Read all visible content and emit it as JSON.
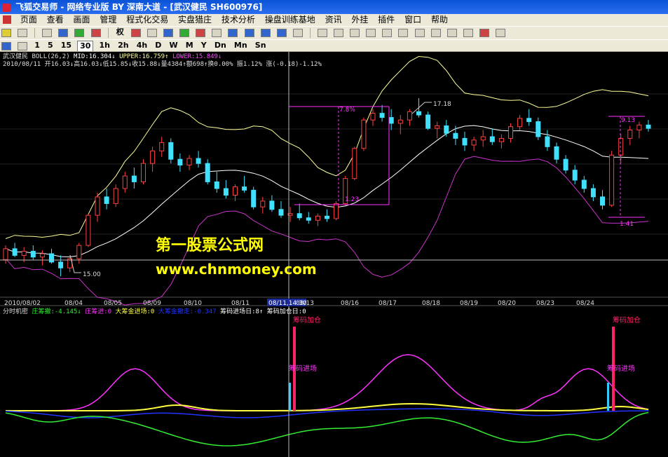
{
  "window": {
    "title": "飞狐交易师 - 网络专业版 BY 深南大道 - [武汉健民 SH600976]"
  },
  "menu": [
    "页面",
    "查看",
    "画面",
    "管理",
    "程式化交易",
    "实盘猎庄",
    "技术分析",
    "操盘训练基地",
    "资讯",
    "外挂",
    "插件",
    "窗口",
    "帮助"
  ],
  "toolbar1": {
    "right_label": "权"
  },
  "periods": [
    {
      "label": "1",
      "active": false
    },
    {
      "label": "5",
      "active": false
    },
    {
      "label": "15",
      "active": false
    },
    {
      "label": "30",
      "active": true
    },
    {
      "label": "1h",
      "active": false
    },
    {
      "label": "2h",
      "active": false
    },
    {
      "label": "4h",
      "active": false
    },
    {
      "label": "D",
      "active": false
    },
    {
      "label": "W",
      "active": false
    },
    {
      "label": "M",
      "active": false
    },
    {
      "label": "Y",
      "active": false
    },
    {
      "label": "Dn",
      "active": false
    },
    {
      "label": "Mn",
      "active": false
    },
    {
      "label": "Sn",
      "active": false
    }
  ],
  "main_info": {
    "stock": "武汉健民",
    "boll": "BOLL(26,2)",
    "mid": "MID:16.304↓",
    "upper": "UPPER:16.759↑",
    "lower": "LOWER:15.849↓",
    "line2": "2010/08/11 开16.03↓高16.03↓低15.85↓收15.88↓量4384↑额698↑换0.00% 振1.12% 涨(-0.18)-1.12%"
  },
  "annotations": {
    "a7_8": "7.8%",
    "a17_18": "17.18",
    "a15_00": "15.00",
    "a1_23": "1.23",
    "a1_41": "1.41",
    "a9_13": "9.13"
  },
  "x_axis": [
    "2010/08/02",
    "08/04",
    "08/05",
    "08/09",
    "08/10",
    "08/11",
    "08/11,14:30",
    "08/13",
    "08/16",
    "08/17",
    "08/18",
    "08/19",
    "08/20",
    "08/23",
    "08/24"
  ],
  "sub_info": {
    "name": "分时机密",
    "a": "庄筹撤:-4.145↓",
    "b": "庄筹进:0",
    "c": "大筹金进场:0",
    "d": "大筹金撤走:-0.347",
    "e": "筹码进场日:8↑",
    "f": "筹码加仓日:0"
  },
  "sub_labels": {
    "jiacang": "筹码加仓",
    "jinchang": "筹码进场"
  },
  "watermark": {
    "line1": "第一股票公式网",
    "line2": "www.chnmoney.com"
  },
  "colors": {
    "bg": "#000000",
    "up_candle": "#ff4040",
    "down_candle": "#40e0ff",
    "upper_band": "#ffff99",
    "mid_band": "#ffffff",
    "lower_band": "#cc33cc",
    "watermark": "#ffff00",
    "osc_magenta": "#ff33ff",
    "osc_yellow": "#ffff40",
    "osc_blue": "#2233ff",
    "osc_green": "#33ee33",
    "bar_pink": "#ff2266",
    "bar_cyan": "#33ccff"
  },
  "chart_data": {
    "type": "candlestick",
    "timeframe": "30",
    "y_min": 14.8,
    "y_max": 17.5,
    "candles": [
      [
        15.25,
        15.42,
        15.2,
        15.38
      ],
      [
        15.38,
        15.45,
        15.28,
        15.3
      ],
      [
        15.3,
        15.4,
        15.22,
        15.35
      ],
      [
        15.35,
        15.42,
        15.25,
        15.28
      ],
      [
        15.28,
        15.36,
        15.18,
        15.32
      ],
      [
        15.32,
        15.38,
        15.2,
        15.22
      ],
      [
        15.22,
        15.3,
        15.05,
        15.15
      ],
      [
        15.15,
        15.3,
        15.1,
        15.26
      ],
      [
        15.26,
        15.45,
        15.2,
        15.42
      ],
      [
        15.42,
        15.8,
        15.4,
        15.78
      ],
      [
        15.78,
        16.05,
        15.7,
        16.0
      ],
      [
        16.0,
        16.1,
        15.85,
        15.92
      ],
      [
        15.92,
        16.15,
        15.88,
        16.1
      ],
      [
        16.1,
        16.3,
        16.05,
        16.25
      ],
      [
        16.25,
        16.35,
        16.1,
        16.18
      ],
      [
        16.18,
        16.45,
        16.15,
        16.4
      ],
      [
        16.4,
        16.6,
        16.3,
        16.55
      ],
      [
        16.55,
        16.72,
        16.48,
        16.65
      ],
      [
        16.65,
        16.7,
        16.4,
        16.45
      ],
      [
        16.45,
        16.52,
        16.3,
        16.38
      ],
      [
        16.38,
        16.5,
        16.32,
        16.46
      ],
      [
        16.46,
        16.55,
        16.35,
        16.4
      ],
      [
        16.4,
        16.45,
        16.15,
        16.18
      ],
      [
        16.18,
        16.3,
        16.05,
        16.1
      ],
      [
        16.1,
        16.2,
        15.98,
        16.02
      ],
      [
        16.02,
        16.15,
        15.95,
        16.12
      ],
      [
        16.12,
        16.25,
        16.05,
        16.08
      ],
      [
        16.08,
        16.12,
        15.85,
        15.88
      ],
      [
        15.88,
        16.0,
        15.8,
        15.95
      ],
      [
        15.95,
        16.02,
        15.82,
        15.85
      ],
      [
        15.85,
        15.95,
        15.75,
        15.78
      ],
      [
        15.78,
        15.88,
        15.7,
        15.8
      ],
      [
        15.8,
        15.92,
        15.72,
        15.75
      ],
      [
        15.75,
        15.82,
        15.68,
        15.72
      ],
      [
        15.72,
        15.8,
        15.65,
        15.77
      ],
      [
        15.77,
        15.85,
        15.7,
        15.74
      ],
      [
        15.74,
        15.95,
        15.72,
        15.92
      ],
      [
        15.92,
        16.25,
        15.9,
        16.22
      ],
      [
        16.22,
        16.6,
        16.2,
        16.58
      ],
      [
        16.58,
        16.95,
        16.55,
        16.92
      ],
      [
        16.92,
        17.05,
        16.85,
        17.0
      ],
      [
        17.0,
        17.1,
        16.9,
        16.95
      ],
      [
        16.95,
        17.05,
        16.8,
        16.88
      ],
      [
        16.88,
        16.98,
        16.75,
        16.92
      ],
      [
        16.92,
        17.05,
        16.85,
        17.02
      ],
      [
        17.02,
        17.18,
        16.95,
        16.98
      ],
      [
        16.98,
        17.02,
        16.8,
        16.82
      ],
      [
        16.82,
        16.9,
        16.7,
        16.85
      ],
      [
        16.85,
        16.92,
        16.72,
        16.76
      ],
      [
        16.76,
        16.85,
        16.62,
        16.7
      ],
      [
        16.7,
        16.78,
        16.55,
        16.62
      ],
      [
        16.62,
        16.72,
        16.55,
        16.68
      ],
      [
        16.68,
        16.8,
        16.6,
        16.72
      ],
      [
        16.72,
        16.82,
        16.62,
        16.66
      ],
      [
        16.66,
        16.75,
        16.58,
        16.7
      ],
      [
        16.7,
        16.88,
        16.65,
        16.84
      ],
      [
        16.84,
        16.98,
        16.8,
        16.94
      ],
      [
        16.94,
        17.05,
        16.85,
        16.9
      ],
      [
        16.9,
        16.95,
        16.68,
        16.72
      ],
      [
        16.72,
        16.8,
        16.55,
        16.6
      ],
      [
        16.6,
        16.65,
        16.4,
        16.45
      ],
      [
        16.45,
        16.5,
        16.28,
        16.32
      ],
      [
        16.32,
        16.38,
        16.15,
        16.2
      ],
      [
        16.2,
        16.25,
        16.05,
        16.1
      ],
      [
        16.1,
        16.15,
        15.95,
        16.0
      ],
      [
        16.0,
        16.08,
        15.85,
        15.9
      ],
      [
        15.9,
        16.55,
        15.88,
        16.5
      ],
      [
        16.5,
        16.75,
        16.4,
        16.7
      ],
      [
        16.7,
        16.85,
        16.62,
        16.8
      ],
      [
        16.8,
        16.9,
        16.7,
        16.86
      ],
      [
        16.86,
        16.92,
        16.78,
        16.82
      ]
    ]
  }
}
